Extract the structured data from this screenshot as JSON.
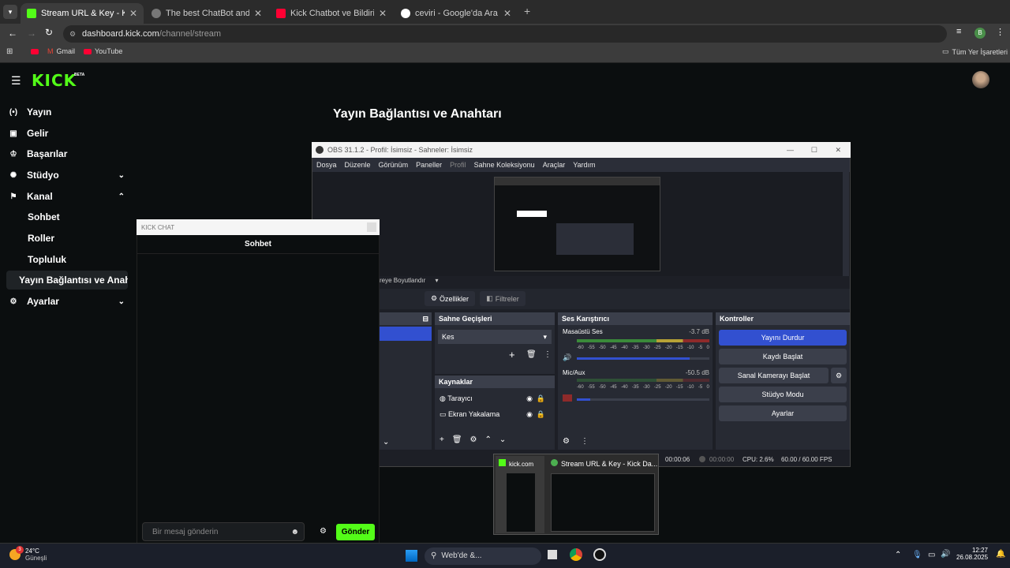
{
  "browser": {
    "tabs": [
      {
        "title": "Stream URL & Key - Kick Dashb",
        "color": "#53fc18",
        "active": true
      },
      {
        "title": "The best ChatBot and Widgets",
        "color": "#555555",
        "active": false
      },
      {
        "title": "Kick Chatbot ve Bildirimler Nas",
        "color": "#ff0033",
        "active": false
      },
      {
        "title": "ceviri - Google'da Ara",
        "color": "#ffffff",
        "active": false
      }
    ],
    "new_tab": "+",
    "url_host": "dashboard.kick.com",
    "url_path": "/channel/stream",
    "profile_initial": "B",
    "bookmarks": [
      "Gmail",
      "YouTube"
    ],
    "all_bookmarks": "Tüm Yer İşaretleri"
  },
  "kick": {
    "logo": "KICK",
    "logo_badge": "BETA",
    "nav": [
      "Yayın",
      "Gelir",
      "Başarılar",
      "Stüdyo",
      "Kanal"
    ],
    "kanal_sub": [
      "Sohbet",
      "Roller",
      "Topluluk",
      "Yayın Bağlantısı ve Anahtarı"
    ],
    "settings": "Ayarlar",
    "page_title": "Yayın Bağlantısı ve Anahtarı"
  },
  "obs": {
    "title": "OBS 31.1.2 - Profil: İsimsiz - Sahneler: İsimsiz",
    "menu": [
      "Dosya",
      "Düzenle",
      "Görünüm",
      "Paneller",
      "Profil",
      "Sahne Koleksiyonu",
      "Araçlar",
      "Yardım"
    ],
    "resize_label": "reye Boyutlandır",
    "properties": "Özellikler",
    "filters": "Filtreler",
    "transitions_title": "Sahne Geçişleri",
    "transition_value": "Kes",
    "sources_title": "Kaynaklar",
    "sources": [
      "Tarayıcı",
      "Ekran Yakalama"
    ],
    "mixer_title": "Ses Karıştırıcı",
    "mixer": [
      {
        "name": "Masaüstü Ses",
        "db": "-3.7 dB",
        "level": 0.85
      },
      {
        "name": "Mic/Aux",
        "db": "-50.5 dB",
        "level": 0.1
      }
    ],
    "ticks": [
      "-60",
      "-55",
      "-50",
      "-45",
      "-40",
      "-35",
      "-30",
      "-25",
      "-20",
      "-15",
      "-10",
      "-5",
      "0"
    ],
    "controls_title": "Kontroller",
    "controls": [
      "Yayını Durdur",
      "Kaydı Başlat",
      "Sanal Kamerayı Başlat",
      "Stüdyo Modu",
      "Ayarlar"
    ],
    "status": {
      "stream_time": "00:00:06",
      "rec_time": "00:00:00",
      "cpu": "CPU: 2.6%",
      "fps": "60.00 / 60.00 FPS"
    }
  },
  "chat": {
    "window_title": "KICK CHAT",
    "header": "Sohbet",
    "placeholder": "Bir mesaj gönderin",
    "send": "Gönder"
  },
  "thumbs": [
    {
      "title": "kick.com"
    },
    {
      "title": "Stream URL & Key - Kick Da..."
    }
  ],
  "taskbar": {
    "weather_badge": "3",
    "temp": "24°C",
    "weather": "Güneşli",
    "search": "Web'de &...",
    "time": "12:27",
    "date": "26.08.2025"
  }
}
